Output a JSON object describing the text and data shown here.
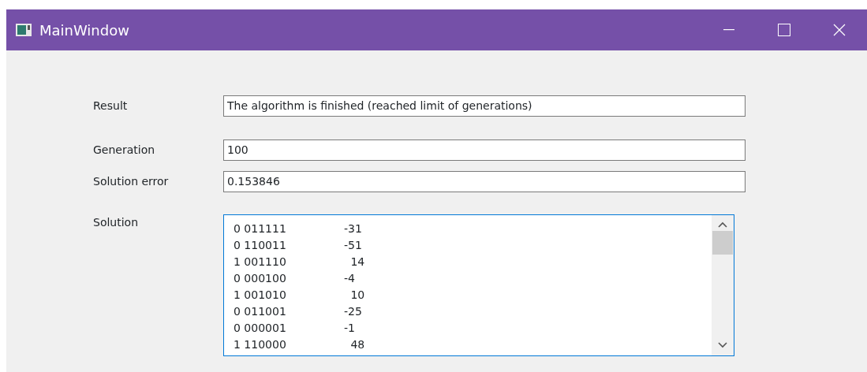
{
  "window": {
    "title": "MainWindow"
  },
  "fields": [
    {
      "label": "Result",
      "value": "The algorithm is finished (reached limit of generations)"
    },
    {
      "label": "Generation",
      "value": "100"
    },
    {
      "label": "Solution error",
      "value": "0.153846"
    }
  ],
  "solution": {
    "label": "Solution",
    "lines": [
      {
        "code": "0 011111",
        "value": "-31"
      },
      {
        "code": "0 110011",
        "value": "-51"
      },
      {
        "code": "1 001110",
        "value": "14"
      },
      {
        "code": "0 000100",
        "value": "-4"
      },
      {
        "code": "1 001010",
        "value": "10"
      },
      {
        "code": "0 011001",
        "value": "-25"
      },
      {
        "code": "0 000001",
        "value": "-1"
      },
      {
        "code": "1 110000",
        "value": "48"
      }
    ]
  }
}
